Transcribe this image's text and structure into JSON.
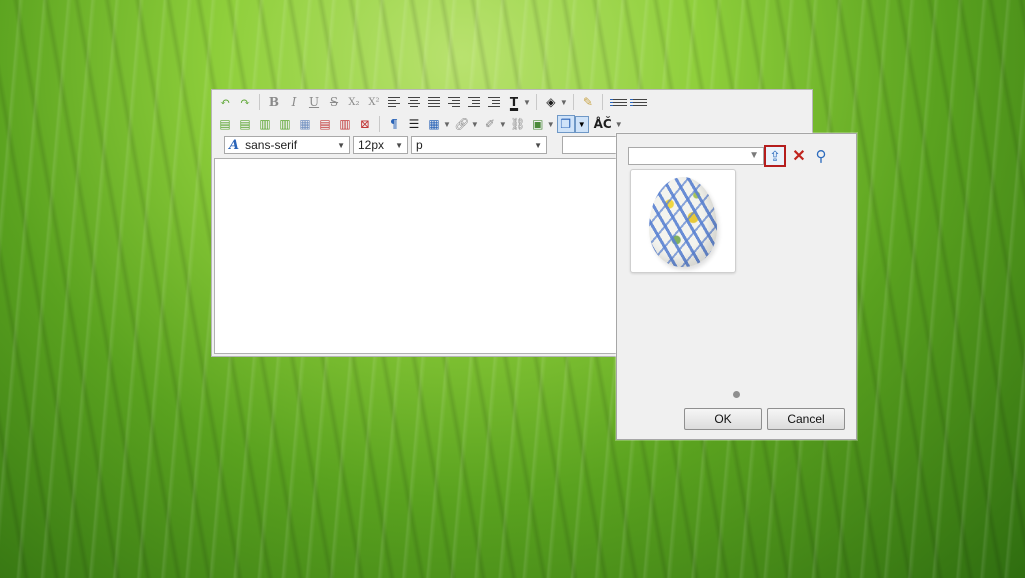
{
  "toolbar": {
    "row1": [
      {
        "icon": "undo-icon",
        "glyph": "⟲"
      },
      {
        "icon": "redo-icon",
        "glyph": "⟳"
      },
      {
        "icon": "bold-icon",
        "glyph": "B"
      },
      {
        "icon": "italic-icon",
        "glyph": "I"
      },
      {
        "icon": "underline-icon",
        "glyph": "U"
      },
      {
        "icon": "strikethrough-icon",
        "glyph": "S"
      },
      {
        "icon": "subscript-icon",
        "glyph": "X₂"
      },
      {
        "icon": "superscript-icon",
        "glyph": "X²"
      },
      {
        "icon": "text-color-icon",
        "glyph": "T"
      },
      {
        "icon": "background-color-icon",
        "glyph": "◈"
      },
      {
        "icon": "clear-formatting-icon",
        "glyph": "✎"
      }
    ],
    "row2_icons": {
      "table_icons": [
        "insert-row-before-icon",
        "insert-row-after-icon",
        "insert-column-before-icon",
        "insert-column-after-icon",
        "merge-cells-icon",
        "delete-row-icon",
        "delete-column-icon",
        "delete-table-icon"
      ],
      "paragraph_glyph": "¶",
      "spellcheck_label": "ÅČ"
    }
  },
  "format_bar": {
    "font_family": "sans-serif",
    "font_size": "12px",
    "block_format": "p"
  },
  "image_dialog": {
    "filter_placeholder": "",
    "filter_value": "",
    "images": [
      {
        "name": "easter-egg-image"
      }
    ],
    "ok_label": "OK",
    "cancel_label": "Cancel"
  }
}
